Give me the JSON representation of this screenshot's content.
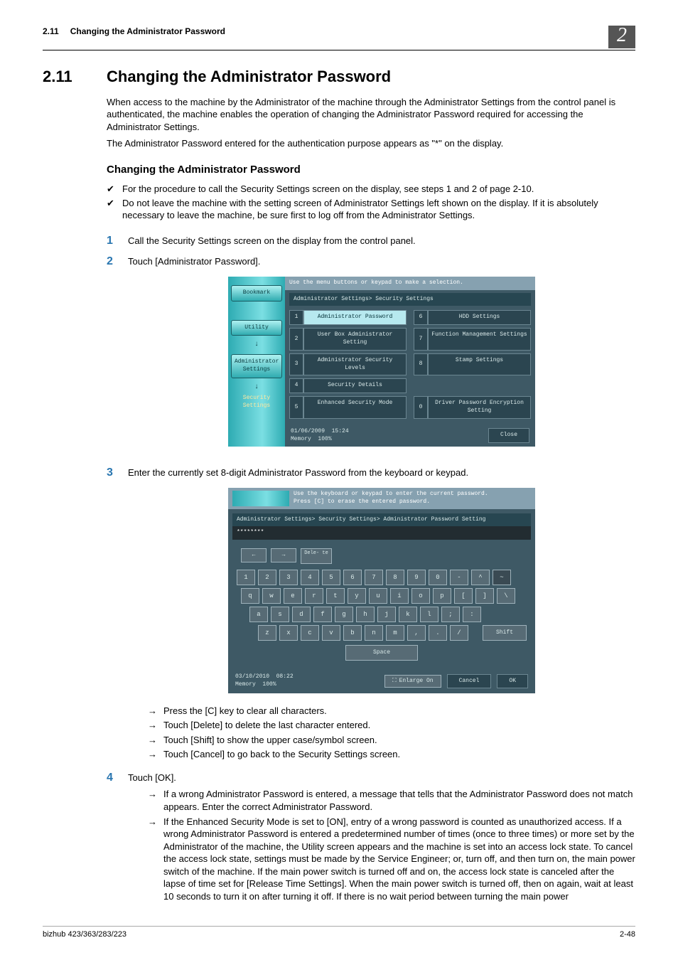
{
  "header": {
    "section_number": "2.11",
    "section_title": "Changing the Administrator Password",
    "chapter_badge": "2"
  },
  "title": {
    "number": "2.11",
    "text": "Changing the Administrator Password"
  },
  "intro_paragraph_1": "When access to the machine by the Administrator of the machine through the Administrator Settings from the control panel is authenticated, the machine enables the operation of changing the Administrator Password required for accessing the Administrator Settings.",
  "intro_paragraph_2": "The Administrator Password entered for the authentication purpose appears as \"*\" on the display.",
  "subheading": "Changing the Administrator Password",
  "checklist": [
    "For the procedure to call the Security Settings screen on the display, see steps 1 and 2 of page 2-10.",
    "Do not leave the machine with the setting screen of Administrator Settings left shown on the display. If it is absolutely necessary to leave the machine, be sure first to log off from the Administrator Settings."
  ],
  "steps": {
    "s1": "Call the Security Settings screen on the display from the control panel.",
    "s2": "Touch [Administrator Password].",
    "s3": "Enter the currently set 8-digit Administrator Password from the keyboard or keypad.",
    "s4": "Touch [OK]."
  },
  "arrows_after_3": [
    "Press the [C] key to clear all characters.",
    "Touch [Delete] to delete the last character entered.",
    "Touch [Shift] to show the upper case/symbol screen.",
    "Touch [Cancel] to go back to the Security Settings screen."
  ],
  "arrows_after_4": [
    "If a wrong Administrator Password is entered, a message that tells that the Administrator Password does not match appears. Enter the correct Administrator Password.",
    "If the Enhanced Security Mode is set to [ON], entry of a wrong password is counted as unauthorized access. If a wrong Administrator Password is entered a predetermined number of times (once to three times) or more set by the Administrator of the machine, the Utility screen appears and the machine is set into an access lock state. To cancel the access lock state, settings must be made by the Service Engineer; or, turn off, and then turn on, the main power switch of the machine. If the main power switch is turned off and on, the access lock state is canceled after the lapse of time set for [Release Time Settings]. When the main power switch is turned off, then on again, wait at least 10 seconds to turn it on after turning it off. If there is no wait period between turning the main power"
  ],
  "screenshot1": {
    "hint": "Use the menu buttons or keypad to make a selection.",
    "bookmark": "Bookmark",
    "utility": "Utility",
    "admin_settings": "Administrator Settings",
    "security_settings": "Security Settings",
    "breadcrumb": "Administrator Settings> Security Settings",
    "items": {
      "i1": "Administrator Password",
      "i2": "User Box Administrator Setting",
      "i3": "Administrator Security Levels",
      "i4": "Security Details",
      "i5": "Enhanced Security Mode",
      "i6": "HDD Settings",
      "i7": "Function Management Settings",
      "i8": "Stamp Settings",
      "i0": "Driver Password Encryption Setting"
    },
    "nums": {
      "n1": "1",
      "n2": "2",
      "n3": "3",
      "n4": "4",
      "n5": "5",
      "n6": "6",
      "n7": "7",
      "n8": "8",
      "n0": "0"
    },
    "date": "01/06/2009",
    "time": "15:24",
    "memory": "Memory",
    "mem_pct": "100%",
    "close": "Close"
  },
  "screenshot2": {
    "hint1": "Use the keyboard or keypad to enter the current password.",
    "hint2": "Press [C] to erase the entered password.",
    "breadcrumb": "Administrator Settings> Security Settings> Administrator Password Setting",
    "password": "********",
    "delete": "Dele- te",
    "keys_row1": [
      "1",
      "2",
      "3",
      "4",
      "5",
      "6",
      "7",
      "8",
      "9",
      "0",
      "-",
      "^"
    ],
    "keys_row2": [
      "q",
      "w",
      "e",
      "r",
      "t",
      "y",
      "u",
      "i",
      "o",
      "p",
      "[",
      "]",
      "\\"
    ],
    "keys_row3": [
      "a",
      "s",
      "d",
      "f",
      "g",
      "h",
      "j",
      "k",
      "l",
      ";",
      ":"
    ],
    "keys_row4": [
      "z",
      "x",
      "c",
      "v",
      "b",
      "n",
      "m",
      ",",
      ".",
      "/"
    ],
    "shift": "Shift",
    "space": "Space",
    "date": "03/10/2010",
    "time": "08:22",
    "memory": "Memory",
    "mem_pct": "100%",
    "enlarge": "Enlarge On",
    "cancel": "Cancel",
    "ok": "OK"
  },
  "footer": {
    "left": "bizhub 423/363/283/223",
    "right": "2-48"
  }
}
